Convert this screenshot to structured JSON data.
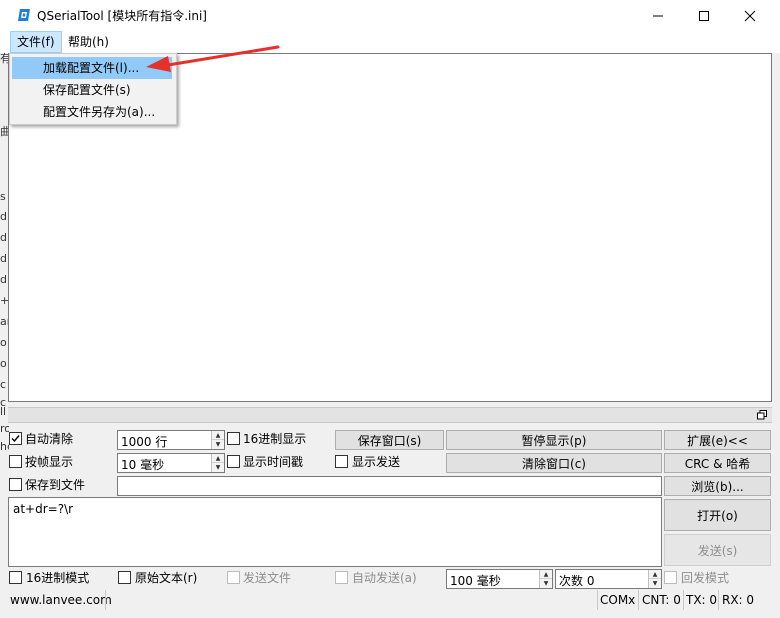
{
  "window": {
    "title": "QSerialTool [模块所有指令.ini]"
  },
  "menubar": {
    "file": "文件(f)",
    "help": "帮助(h)"
  },
  "file_menu": {
    "items": [
      "加载配置文件(l)...",
      "保存配置文件(s)",
      "配置文件另存为(a)..."
    ]
  },
  "background_fragments": [
    "有",
    "曲",
    "s",
    "dl",
    "dl",
    "dl",
    "d",
    "+",
    "ar",
    "o",
    "o",
    "c",
    "c",
    "ll",
    "ro",
    "he"
  ],
  "controls": {
    "auto_clear": {
      "label": "自动清除",
      "checked": true
    },
    "frame_display": {
      "label": "按帧显示",
      "checked": false
    },
    "save_to_file": {
      "label": "保存到文件",
      "checked": false
    },
    "hex_display": {
      "label": "16进制显示",
      "checked": false
    },
    "show_timestamp": {
      "label": "显示时间戳",
      "checked": false
    },
    "show_send": {
      "label": "显示发送",
      "checked": false
    },
    "max_lines": "1000 行",
    "frame_interval": "10 毫秒",
    "save_window_button": "保存窗口(s)",
    "pause_display_button": "暂停显示(p)",
    "clear_window_button": "清除窗口(c)",
    "expand_button": "扩展(e)<<",
    "crc_hash_button": "CRC & 哈希",
    "browse_button": "浏览(b)...",
    "save_file_path": "",
    "send_text": "at+dr=?\\r",
    "open_button": "打开(o)",
    "send_button": "发送(s)",
    "hex_mode": {
      "label": "16进制模式",
      "checked": false
    },
    "raw_text": {
      "label": "原始文本(r)",
      "checked": false
    },
    "send_file": {
      "label": "发送文件",
      "checked": false,
      "disabled": true
    },
    "auto_send": {
      "label": "自动发送(a)",
      "checked": false,
      "disabled": true
    },
    "auto_send_interval": "100 毫秒",
    "send_count": "次数 0",
    "echo_mode": {
      "label": "回发模式",
      "checked": false,
      "disabled": true
    }
  },
  "statusbar": {
    "website": "www.lanvee.com",
    "port": "COMx",
    "cnt": "CNT: 0",
    "tx": "TX: 0",
    "rx": "RX: 0"
  },
  "colors": {
    "menu_highlight": "#91c9f7",
    "menu_open": "#cce8ff",
    "arrow": "#e8302a",
    "app_icon": "#1e7fd6"
  },
  "icons": [
    "app-icon",
    "minimize-icon",
    "maximize-icon",
    "close-icon",
    "restore-icon",
    "checkmark-icon",
    "spin-up-icon",
    "spin-down-icon",
    "annotation-arrow"
  ]
}
